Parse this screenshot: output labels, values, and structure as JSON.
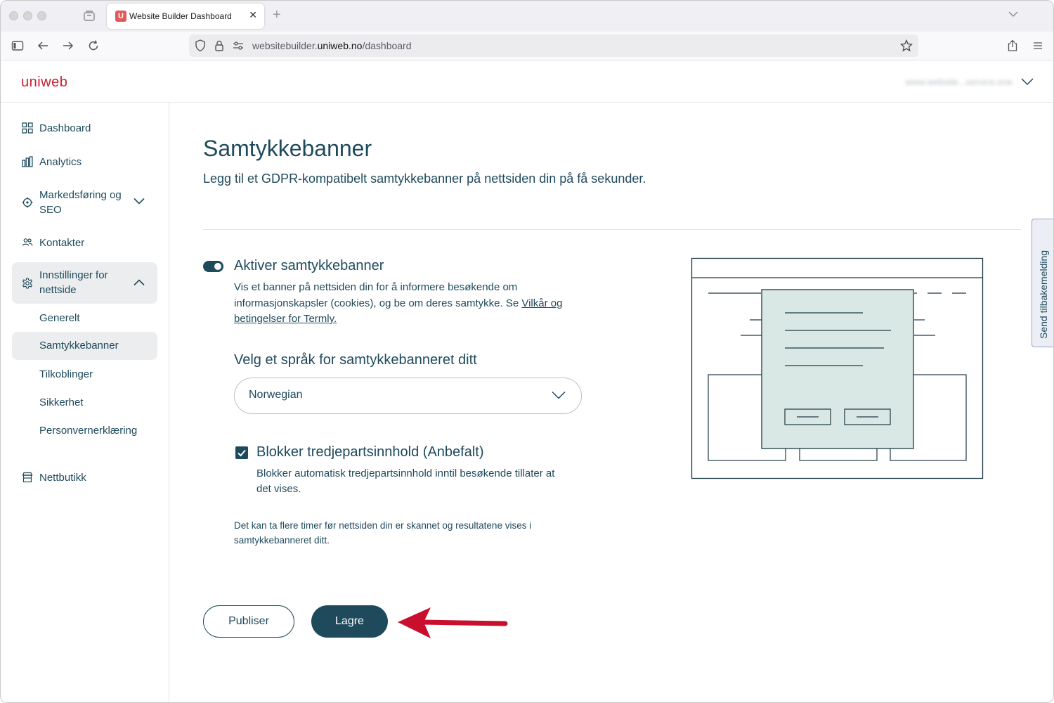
{
  "browser": {
    "tab_title": "Website Builder Dashboard",
    "tab_favicon_letter": "U",
    "url_prefix": "websitebuilder.",
    "url_domain": "uniweb.no",
    "url_path": "/dashboard"
  },
  "header": {
    "logo": "uniweb",
    "site_selector": "www.website...service.one"
  },
  "sidebar": {
    "items": [
      {
        "label": "Dashboard",
        "icon": "grid-icon"
      },
      {
        "label": "Analytics",
        "icon": "bar-chart-icon"
      },
      {
        "label": "Markedsføring og SEO",
        "icon": "target-icon"
      },
      {
        "label": "Kontakter",
        "icon": "users-icon"
      },
      {
        "label": "Innstillinger for nettside",
        "icon": "gear-icon"
      },
      {
        "label": "Nettbutikk",
        "icon": "store-icon"
      }
    ],
    "submenu": [
      {
        "label": "Generelt"
      },
      {
        "label": "Samtykkebanner"
      },
      {
        "label": "Tilkoblinger"
      },
      {
        "label": "Sikkerhet"
      },
      {
        "label": "Personvernerklæring"
      }
    ]
  },
  "main": {
    "title": "Samtykkebanner",
    "subtitle": "Legg til et GDPR-kompatibelt samtykkebanner på nettsiden din på få sekunder.",
    "toggle": {
      "label": "Aktiver samtykkebanner",
      "enabled": true,
      "description": "Vis et banner på nettsiden din for å informere besøkende om informasjonskapsler (cookies), og be om deres samtykke. Se ",
      "link": "Vilkår og betingelser for Termly."
    },
    "language": {
      "label": "Velg et språk for samtykkebanneret ditt",
      "value": "Norwegian"
    },
    "block": {
      "label": "Blokker tredjepartsinnhold (Anbefalt)",
      "checked": true,
      "description": "Blokker automatisk tredjepartsinnhold inntil besøkende tillater at det vises."
    },
    "note": "Det kan ta flere timer før nettsiden din er skannet og resultatene vises i samtykkebanneret ditt.",
    "buttons": {
      "publish": "Publiser",
      "save": "Lagre"
    }
  },
  "feedback_tab": "Send tilbakemelding",
  "colors": {
    "primary": "#1e4a5c",
    "brand": "#c8202f",
    "arrow": "#c8102e",
    "illustration_fill": "#d9e8e5"
  }
}
